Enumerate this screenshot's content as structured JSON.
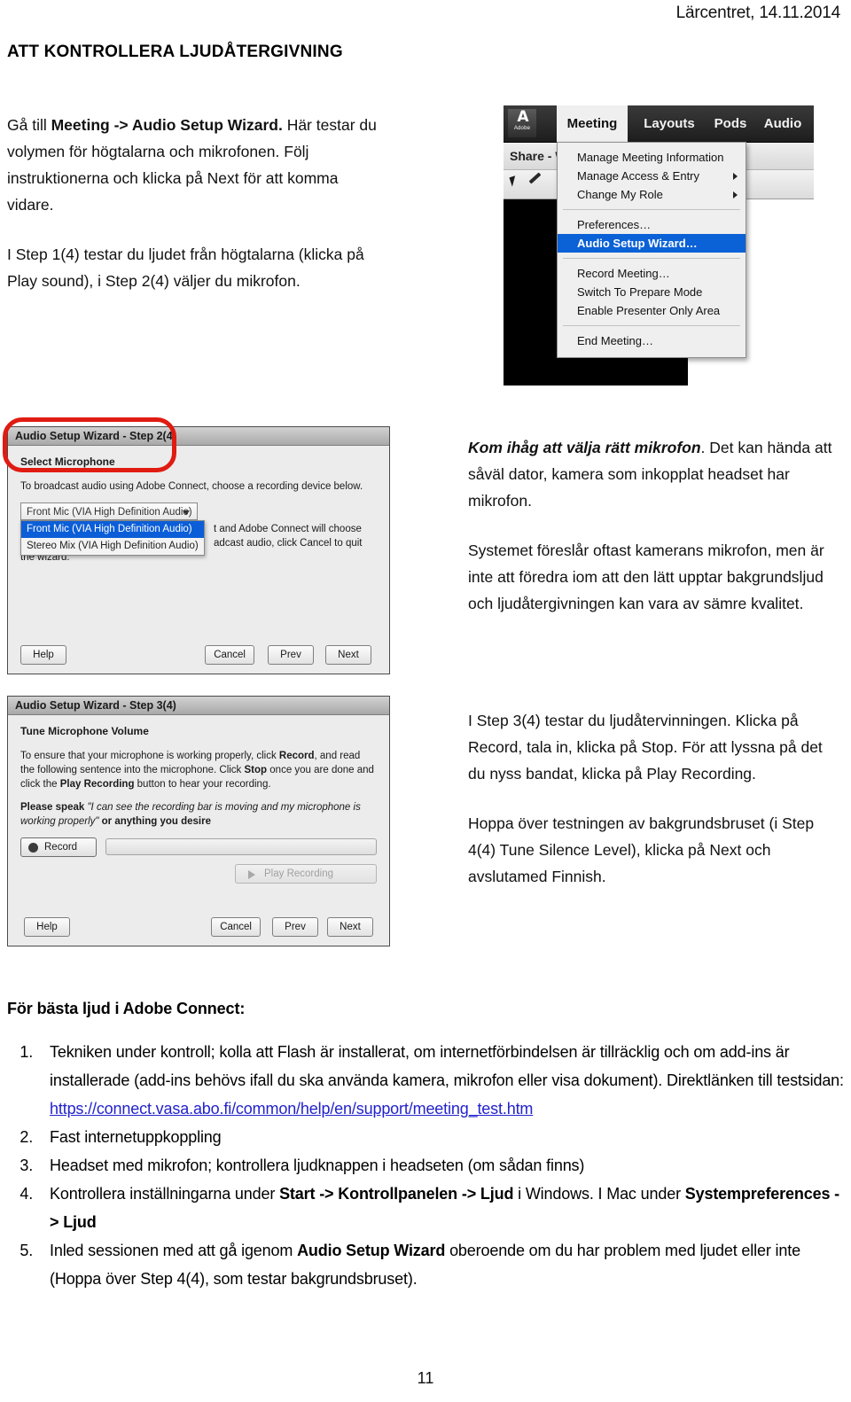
{
  "page": {
    "header_right": "Lärcentret, 14.11.2014",
    "title": "ATT KONTROLLERA LJUDÅTERGIVNING",
    "number": "11"
  },
  "intro": {
    "p1_bold": "Meeting -> Audio Setup Wizard.",
    "p1_pre": "Gå till ",
    "p1_post": " Här testar du volymen för högtalarna och mikrofonen. Följ instruktionerna och klicka på Next för att komma vidare.",
    "p2": "I Step 1(4) testar du ljudet från högtalarna (klicka på Play sound), i Step 2(4) väljer du mikrofon."
  },
  "menu_shot": {
    "logo_glyph": "A",
    "logo_word": "Adobe",
    "menubar": [
      "Meeting",
      "Layouts",
      "Pods",
      "Audio"
    ],
    "toolbar_label": "Share - W",
    "dropdown": [
      {
        "label": "Manage Meeting Information",
        "submenu": false,
        "selected": false
      },
      {
        "label": "Manage Access & Entry",
        "submenu": true,
        "selected": false
      },
      {
        "label": "Change My Role",
        "submenu": true,
        "selected": false
      },
      {
        "label": "Preferences…",
        "submenu": false,
        "selected": false
      },
      {
        "label": "Audio Setup Wizard…",
        "submenu": false,
        "selected": true
      },
      {
        "label": "Record Meeting…",
        "submenu": false,
        "selected": false
      },
      {
        "label": "Switch To Prepare Mode",
        "submenu": false,
        "selected": false
      },
      {
        "label": "Enable Presenter Only Area",
        "submenu": false,
        "selected": false
      },
      {
        "label": "End Meeting…",
        "submenu": false,
        "selected": false
      }
    ],
    "highlight_color": "#0b61d6"
  },
  "wizard_step2": {
    "title": "Audio Setup Wizard - Step 2(4)",
    "subtitle": "Select Microphone",
    "instruction": "To broadcast audio using Adobe Connect, choose a recording device below.",
    "select_value": "Front Mic (VIA High Definition Audio)",
    "options": [
      "Front Mic (VIA High Definition Audio)",
      "Stereo Mix (VIA High Definition Audio)"
    ],
    "selected_option_index": 0,
    "obscured_text_1": "t and Adobe Connect will choose",
    "obscured_text_2": "adcast audio, click Cancel to quit",
    "obscured_text_3": "the wizard.",
    "buttons": {
      "help": "Help",
      "cancel": "Cancel",
      "prev": "Prev",
      "next": "Next"
    },
    "annotation_color": "#e01b12"
  },
  "wizard_step3": {
    "title": "Audio Setup Wizard - Step 3(4)",
    "subtitle": "Tune Microphone Volume",
    "para_parts": {
      "a": "To ensure that your microphone is working properly, click ",
      "record": "Record",
      "b": ", and read the following sentence into the microphone. Click ",
      "stop": "Stop",
      "c": " once you are done and click the ",
      "playrec": "Play Recording",
      "d": " button to hear your recording."
    },
    "speak_label": "Please speak",
    "speak_quote": "\"I can see the recording bar is moving and my microphone is working properly\"",
    "speak_tail": " or anything you desire",
    "record_button": "Record",
    "play_recording_button": "Play Recording",
    "buttons": {
      "help": "Help",
      "cancel": "Cancel",
      "prev": "Prev",
      "next": "Next"
    }
  },
  "notes": {
    "n1_bold": "Kom ihåg att välja rätt mikrofon",
    "n1_rest": ". Det kan hända att såväl dator, kamera som inkopplat headset har mikrofon.",
    "n2": "Systemet föreslår oftast kamerans mikrofon, men är inte att föredra iom att den lätt upptar bakgrundsljud och ljudåtergivningen kan vara av sämre kvalitet.",
    "n3": "I Step 3(4) testar du ljudåtervinningen. Klicka på Record, tala in, klicka på Stop. För att lyssna på det du nyss bandat, klicka på Play Recording.",
    "n4": "Hoppa över testningen av bakgrundsbruset (i Step 4(4) Tune Silence Level), klicka på Next och avslutamed Finnish."
  },
  "bottom": {
    "heading": "För bästa ljud i Adobe Connect:",
    "item1_text": "Tekniken under kontroll; kolla att Flash är installerat, om internetförbindelsen är tillräcklig och om add-ins är installerade (add-ins behövs ifall du ska använda kamera, mikrofon eller visa dokument). Direktlänken till testsidan:",
    "item1_link": "https://connect.vasa.abo.fi/common/help/en/support/meeting_test.htm",
    "item2": "Fast internetuppkoppling",
    "item3": "Headset med mikrofon; kontrollera ljudknappen i headseten (om sådan finns)",
    "item4_a": "Kontrollera inställningarna under ",
    "item4_b": "Start -> Kontrollpanelen -> Ljud",
    "item4_c": " i Windows. I Mac under ",
    "item4_d": "Systempreferences -> Ljud",
    "item5_a": "Inled sessionen med att gå igenom ",
    "item5_b": "Audio Setup Wizard",
    "item5_c": " oberoende om du har problem med ljudet eller inte (Hoppa över Step 4(4), som testar bakgrundsbruset).",
    "link_color": "#2222cc"
  }
}
